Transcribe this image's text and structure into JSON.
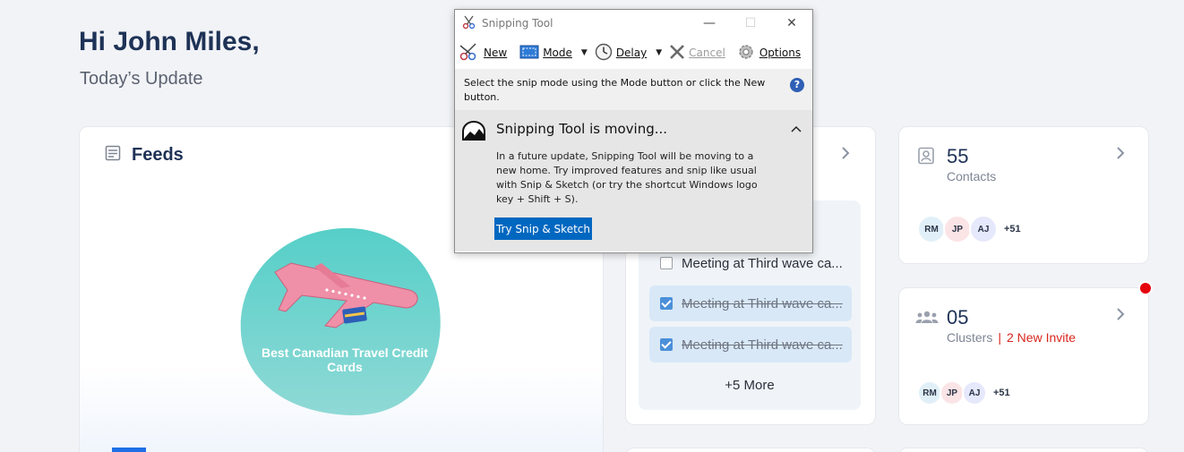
{
  "greeting": "Hi John Miles,",
  "subgreeting": "Today’s Update",
  "feeds": {
    "title": "Feeds",
    "caption": "Best Canadian Travel Credit Cards"
  },
  "tasks": {
    "items": [
      {
        "label": "Meeting at Third wave ca...",
        "done": false
      },
      {
        "label": "Meeting at Third wave ca...",
        "done": true
      },
      {
        "label": "Meeting at Third wave ca...",
        "done": true
      }
    ],
    "more": "+5 More"
  },
  "contacts": {
    "count": "55",
    "label": "Contacts",
    "avatars": [
      "RM",
      "JP",
      "AJ"
    ],
    "more": "+51"
  },
  "clusters": {
    "count": "05",
    "label": "Clusters",
    "separator": "|",
    "invite": "2 New Invite",
    "avatars": [
      "RM",
      "JP",
      "AJ"
    ],
    "more": "+51"
  },
  "snipping_tool": {
    "title": "Snipping Tool",
    "toolbar": {
      "new": "New",
      "mode": "Mode",
      "delay": "Delay",
      "cancel": "Cancel",
      "options": "Options"
    },
    "info": "Select the snip mode using the Mode button or click the New button.",
    "notice_title": "Snipping Tool is moving...",
    "notice_body": "In a future update, Snipping Tool will be moving to a new home. Try improved features and snip like usual with Snip & Sketch (or try the shortcut Windows logo key + Shift + S).",
    "notice_button": "Try Snip & Sketch"
  },
  "colors": {
    "accent": "#1f6fe5",
    "alert": "#e5000c",
    "invite": "#d9251d",
    "snip_button": "#0067c0"
  }
}
